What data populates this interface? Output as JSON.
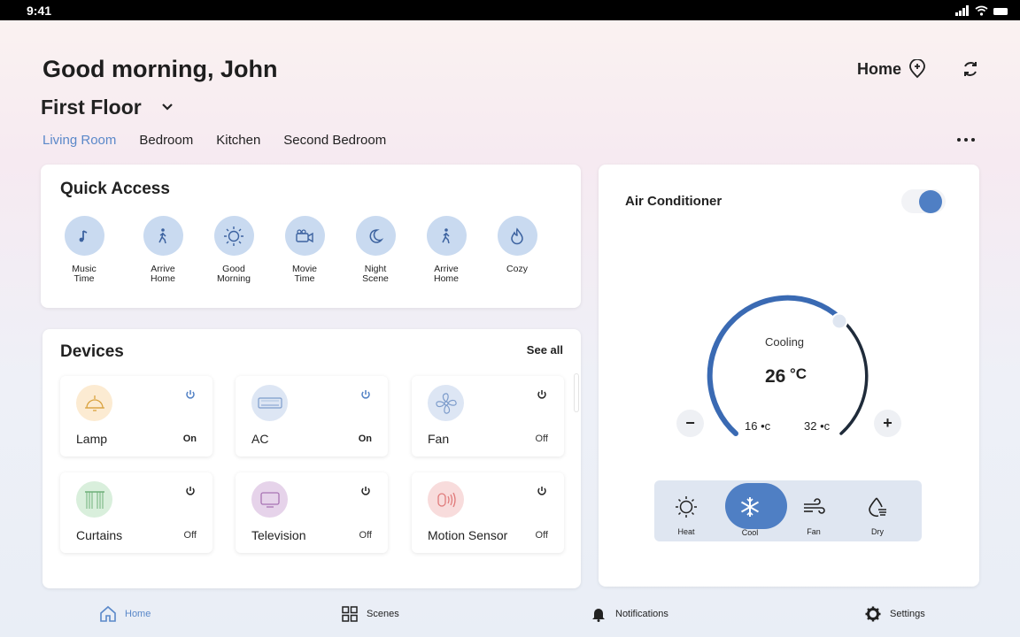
{
  "status_bar": {
    "time": "9:41"
  },
  "header": {
    "greeting": "Good morning, John",
    "home_label": "Home",
    "floor": "First Floor"
  },
  "rooms": [
    "Living Room",
    "Bedroom",
    "Kitchen",
    "Second Bedroom"
  ],
  "active_room": "Living Room",
  "quick_access": {
    "title": "Quick Access",
    "items": [
      {
        "label": "Music\nTime",
        "icon": "music-note-icon"
      },
      {
        "label": "Arrive\nHome",
        "icon": "walking-person-icon"
      },
      {
        "label": "Good\nMorning",
        "icon": "sun-icon"
      },
      {
        "label": "Movie\nTime",
        "icon": "video-camera-icon"
      },
      {
        "label": "Night\nScene",
        "icon": "moon-icon"
      },
      {
        "label": "Arrive\nHome",
        "icon": "walking-person-icon"
      },
      {
        "label": "Cozy",
        "icon": "flame-icon"
      }
    ]
  },
  "devices": {
    "title": "Devices",
    "see_all": "See all",
    "items": [
      {
        "name": "Lamp",
        "state": "On",
        "icon": "lamp-icon",
        "color": "#fcebd2"
      },
      {
        "name": "AC",
        "state": "On",
        "icon": "air-conditioner-icon",
        "color": "#dde6f4"
      },
      {
        "name": "Fan",
        "state": "Off",
        "icon": "fan-icon",
        "color": "#dde6f4"
      },
      {
        "name": "Curtains",
        "state": "Off",
        "icon": "curtains-icon",
        "color": "#d9efdc"
      },
      {
        "name": "Television",
        "state": "Off",
        "icon": "television-icon",
        "color": "#e6d3ea"
      },
      {
        "name": "Motion Sensor",
        "state": "Off",
        "icon": "motion-sensor-icon",
        "color": "#f8dcdc"
      }
    ]
  },
  "air_conditioner": {
    "title": "Air Conditioner",
    "power_on": true,
    "mode_text": "Cooling",
    "temperature": "26",
    "unit": "°C",
    "min": "16 •c",
    "max": "32 •c",
    "minus_label": "−",
    "plus_label": "+",
    "modes": [
      {
        "label": "Heat",
        "icon": "sun-icon"
      },
      {
        "label": "Cool",
        "icon": "snowflake-icon"
      },
      {
        "label": "Fan",
        "icon": "wind-icon"
      },
      {
        "label": "Dry",
        "icon": "water-drop-icon"
      }
    ],
    "active_mode": "Cool"
  },
  "bottom_nav": [
    {
      "label": "Home",
      "icon": "home-icon"
    },
    {
      "label": "Scenes",
      "icon": "grid-icon"
    },
    {
      "label": "Notifications",
      "icon": "bell-icon"
    },
    {
      "label": "Settings",
      "icon": "gear-icon"
    }
  ],
  "colors": {
    "accent": "#4f7fc4",
    "active_tab": "#5a88c9",
    "dial_arc": "#3a6ab3",
    "dial_track": "#1f2b3a"
  }
}
